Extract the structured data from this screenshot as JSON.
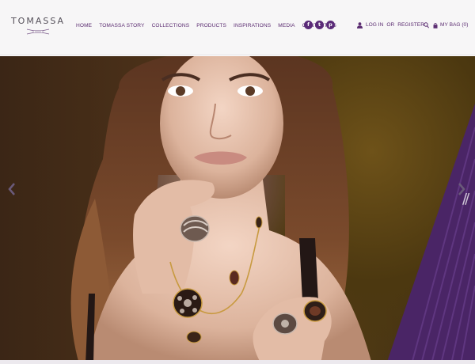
{
  "brand": {
    "name": "TOMASSA"
  },
  "nav": {
    "items": [
      {
        "label": "HOME"
      },
      {
        "label": "TOMASSA STORY"
      },
      {
        "label": "COLLECTIONS"
      },
      {
        "label": "PRODUCTS"
      },
      {
        "label": "INSPIRATIONS"
      },
      {
        "label": "MEDIA"
      },
      {
        "label": "CONTACT US"
      }
    ]
  },
  "social": {
    "items": [
      {
        "icon": "facebook-icon",
        "glyph": "f"
      },
      {
        "icon": "twitter-icon",
        "glyph": "t"
      },
      {
        "icon": "pinterest-icon",
        "glyph": "p"
      }
    ]
  },
  "account": {
    "login_label": "LOG IN",
    "or_label": "OR",
    "register_label": "REGISTER",
    "icon": "user-icon"
  },
  "search": {
    "icon": "search-icon"
  },
  "bag": {
    "label": "MY BAG (0)",
    "icon": "bag-icon"
  },
  "hero": {
    "prev_icon": "chevron-left-icon",
    "next_icon": "chevron-right-icon",
    "decoration_glyph": "//"
  },
  "colors": {
    "accent": "#5a2a78",
    "nav_text": "#5c2e72",
    "header_bg": "#f7f6f7",
    "hero_stripe": "#4a2566"
  }
}
